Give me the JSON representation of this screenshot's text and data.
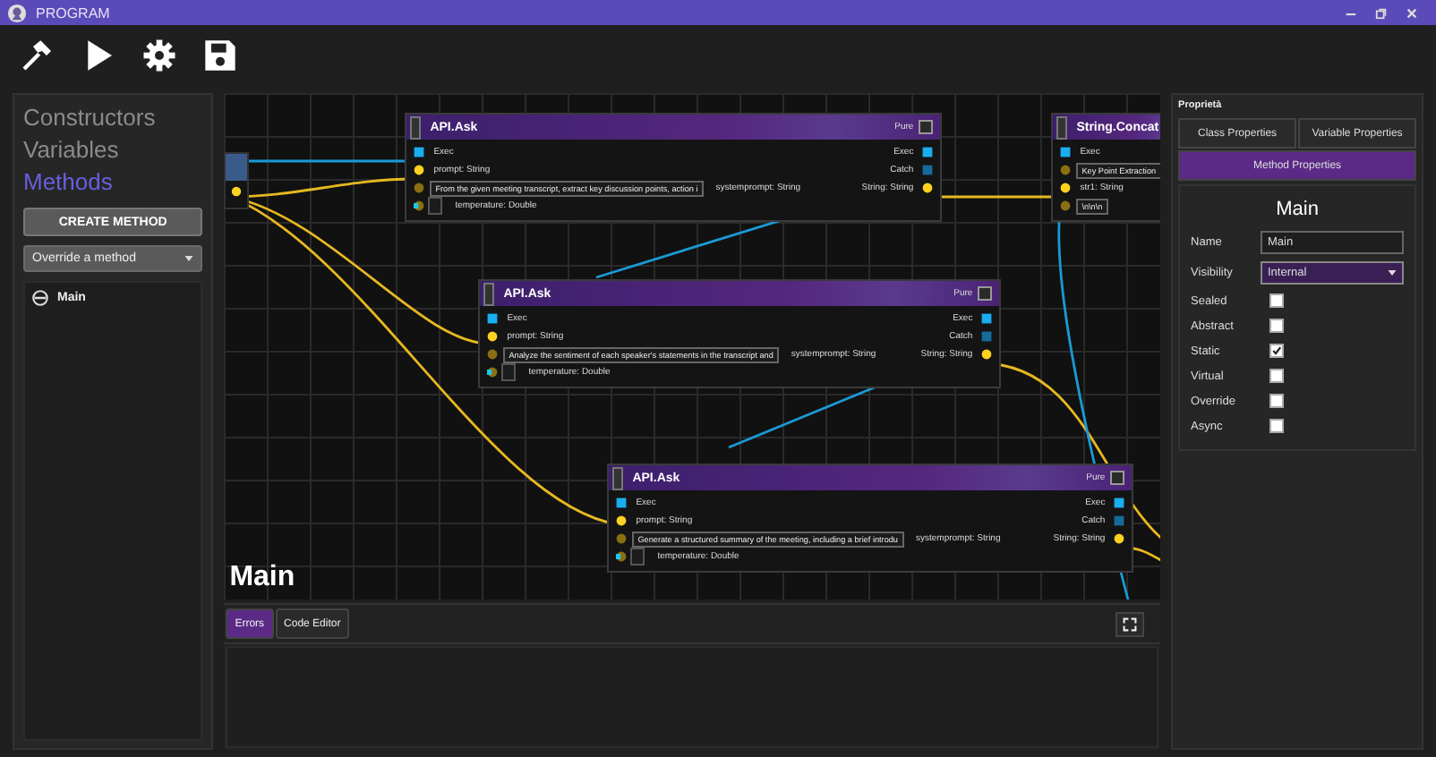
{
  "window": {
    "title": "PROGRAM"
  },
  "left_panel": {
    "tabs": [
      {
        "label": "Constructors",
        "selected": false
      },
      {
        "label": "Variables",
        "selected": false
      },
      {
        "label": "Methods",
        "selected": true
      }
    ],
    "create_button": "CREATE METHOD",
    "override_dropdown": {
      "value": "Override a method"
    },
    "methods": [
      {
        "name": "Main"
      }
    ]
  },
  "canvas": {
    "title": "Main",
    "nodes": [
      {
        "title": "API.Ask",
        "pure_label": "Pure",
        "pure": false,
        "inputs": [
          {
            "kind": "exec",
            "label": "Exec"
          },
          {
            "kind": "data",
            "label": "prompt: String"
          },
          {
            "kind": "field",
            "value": "From the given meeting transcript, extract key discussion points, action i",
            "label": "systemprompt: String"
          },
          {
            "kind": "number",
            "label": "temperature: Double"
          }
        ],
        "outputs": [
          {
            "kind": "exec",
            "label": "Exec"
          },
          {
            "kind": "catch",
            "label": "Catch"
          },
          {
            "kind": "data",
            "label": "String: String"
          }
        ]
      },
      {
        "title": "API.Ask",
        "pure_label": "Pure",
        "pure": false,
        "inputs": [
          {
            "kind": "exec",
            "label": "Exec"
          },
          {
            "kind": "data",
            "label": "prompt: String"
          },
          {
            "kind": "field",
            "value": "Analyze the sentiment of each speaker's statements in the transcript and",
            "label": "systemprompt: String"
          },
          {
            "kind": "number",
            "label": "temperature: Double"
          }
        ],
        "outputs": [
          {
            "kind": "exec",
            "label": "Exec"
          },
          {
            "kind": "catch",
            "label": "Catch"
          },
          {
            "kind": "data",
            "label": "String: String"
          }
        ]
      },
      {
        "title": "API.Ask",
        "pure_label": "Pure",
        "pure": false,
        "inputs": [
          {
            "kind": "exec",
            "label": "Exec"
          },
          {
            "kind": "data",
            "label": "prompt: String"
          },
          {
            "kind": "field",
            "value": "Generate a structured summary of the meeting, including a brief introdu",
            "label": "systemprompt: String"
          },
          {
            "kind": "number",
            "label": "temperature: Double"
          }
        ],
        "outputs": [
          {
            "kind": "exec",
            "label": "Exec"
          },
          {
            "kind": "catch",
            "label": "Catch"
          },
          {
            "kind": "data",
            "label": "String: String"
          }
        ]
      },
      {
        "title": "String.Concat",
        "inputs": [
          {
            "kind": "exec",
            "label": "Exec"
          },
          {
            "kind": "field",
            "value": "Key Point Extraction"
          },
          {
            "kind": "data",
            "label": "str1: String"
          },
          {
            "kind": "field",
            "value": "\\n\\n\\n"
          }
        ]
      }
    ]
  },
  "bottom_panel": {
    "tabs": [
      {
        "label": "Errors",
        "selected": true
      },
      {
        "label": "Code Editor",
        "selected": false
      }
    ]
  },
  "properties": {
    "heading": "Proprietà",
    "tabs": [
      {
        "label": "Class Properties",
        "selected": false
      },
      {
        "label": "Variable Properties",
        "selected": false
      },
      {
        "label": "Method Properties",
        "selected": true
      }
    ],
    "title": "Main",
    "name_label": "Name",
    "name_value": "Main",
    "visibility_label": "Visibility",
    "visibility_value": "Internal",
    "checkboxes": [
      {
        "label": "Sealed",
        "checked": false
      },
      {
        "label": "Abstract",
        "checked": false
      },
      {
        "label": "Static",
        "checked": true
      },
      {
        "label": "Virtual",
        "checked": false
      },
      {
        "label": "Override",
        "checked": false
      },
      {
        "label": "Async",
        "checked": false
      }
    ]
  }
}
